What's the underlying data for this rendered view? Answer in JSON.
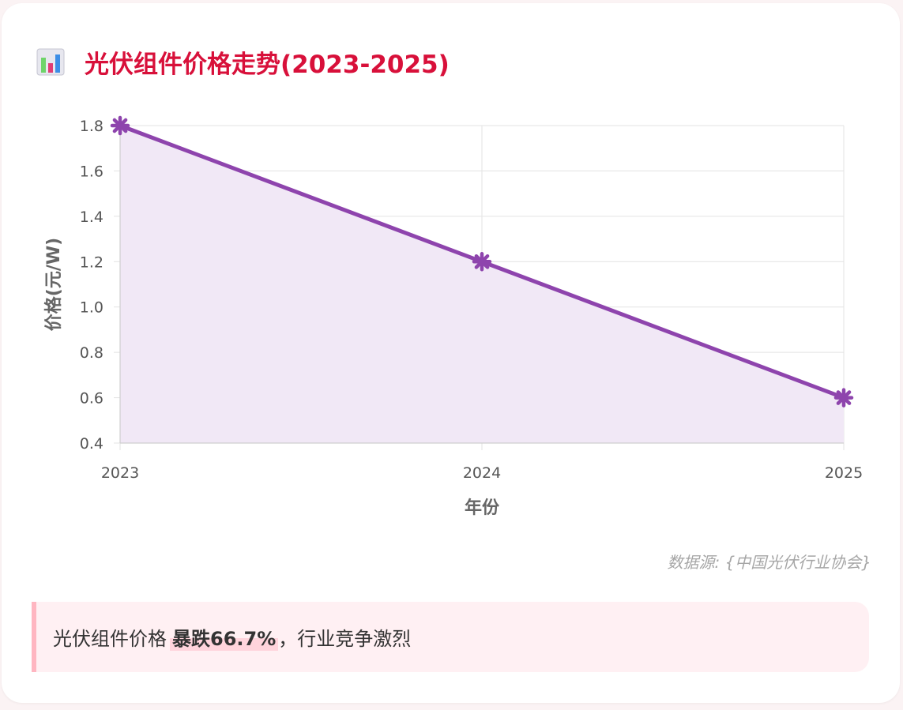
{
  "header": {
    "title": "光伏组件价格走势(2023-2025)",
    "icon": "bar-chart-icon"
  },
  "chart_data": {
    "type": "area",
    "x": [
      "2023",
      "2024",
      "2025"
    ],
    "series": [
      {
        "values": [
          1.8,
          1.2,
          0.6
        ]
      }
    ],
    "xlabel": "年份",
    "ylabel": "价格(元/W)",
    "ylim": [
      0.4,
      1.8
    ],
    "yticks": [
      "0.4",
      "0.6",
      "0.8",
      "1.0",
      "1.2",
      "1.4",
      "1.6",
      "1.8"
    ],
    "grid": true,
    "marker": "asterisk",
    "colors": {
      "line": "#8e44ad",
      "fill": "#f1e8f6",
      "grid": "#e3e3e3",
      "tick_text": "#555555",
      "axis_label": "#666666"
    }
  },
  "source": {
    "text": "数据源: {中国光伏行业协会}"
  },
  "note": {
    "prefix": "光伏组件价格",
    "highlight": "暴跌66.7%",
    "suffix": "，行业竞争激烈"
  },
  "colors": {
    "title": "#d8103a",
    "note_border": "#ffb6c1",
    "note_bg": "#fff0f3"
  }
}
